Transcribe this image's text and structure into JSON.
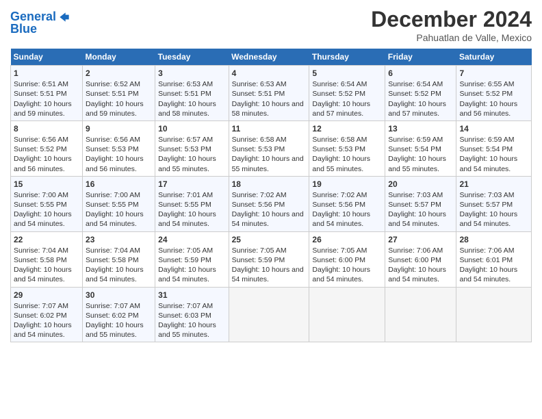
{
  "header": {
    "logo_line1": "General",
    "logo_line2": "Blue",
    "title": "December 2024",
    "subtitle": "Pahuatlan de Valle, Mexico"
  },
  "calendar": {
    "days_of_week": [
      "Sunday",
      "Monday",
      "Tuesday",
      "Wednesday",
      "Thursday",
      "Friday",
      "Saturday"
    ],
    "weeks": [
      [
        {
          "day": "1",
          "sunrise": "6:51 AM",
          "sunset": "5:51 PM",
          "daylight": "10 hours and 59 minutes."
        },
        {
          "day": "2",
          "sunrise": "6:52 AM",
          "sunset": "5:51 PM",
          "daylight": "10 hours and 59 minutes."
        },
        {
          "day": "3",
          "sunrise": "6:53 AM",
          "sunset": "5:51 PM",
          "daylight": "10 hours and 58 minutes."
        },
        {
          "day": "4",
          "sunrise": "6:53 AM",
          "sunset": "5:51 PM",
          "daylight": "10 hours and 58 minutes."
        },
        {
          "day": "5",
          "sunrise": "6:54 AM",
          "sunset": "5:52 PM",
          "daylight": "10 hours and 57 minutes."
        },
        {
          "day": "6",
          "sunrise": "6:54 AM",
          "sunset": "5:52 PM",
          "daylight": "10 hours and 57 minutes."
        },
        {
          "day": "7",
          "sunrise": "6:55 AM",
          "sunset": "5:52 PM",
          "daylight": "10 hours and 56 minutes."
        }
      ],
      [
        {
          "day": "8",
          "sunrise": "6:56 AM",
          "sunset": "5:52 PM",
          "daylight": "10 hours and 56 minutes."
        },
        {
          "day": "9",
          "sunrise": "6:56 AM",
          "sunset": "5:53 PM",
          "daylight": "10 hours and 56 minutes."
        },
        {
          "day": "10",
          "sunrise": "6:57 AM",
          "sunset": "5:53 PM",
          "daylight": "10 hours and 55 minutes."
        },
        {
          "day": "11",
          "sunrise": "6:58 AM",
          "sunset": "5:53 PM",
          "daylight": "10 hours and 55 minutes."
        },
        {
          "day": "12",
          "sunrise": "6:58 AM",
          "sunset": "5:53 PM",
          "daylight": "10 hours and 55 minutes."
        },
        {
          "day": "13",
          "sunrise": "6:59 AM",
          "sunset": "5:54 PM",
          "daylight": "10 hours and 55 minutes."
        },
        {
          "day": "14",
          "sunrise": "6:59 AM",
          "sunset": "5:54 PM",
          "daylight": "10 hours and 54 minutes."
        }
      ],
      [
        {
          "day": "15",
          "sunrise": "7:00 AM",
          "sunset": "5:55 PM",
          "daylight": "10 hours and 54 minutes."
        },
        {
          "day": "16",
          "sunrise": "7:00 AM",
          "sunset": "5:55 PM",
          "daylight": "10 hours and 54 minutes."
        },
        {
          "day": "17",
          "sunrise": "7:01 AM",
          "sunset": "5:55 PM",
          "daylight": "10 hours and 54 minutes."
        },
        {
          "day": "18",
          "sunrise": "7:02 AM",
          "sunset": "5:56 PM",
          "daylight": "10 hours and 54 minutes."
        },
        {
          "day": "19",
          "sunrise": "7:02 AM",
          "sunset": "5:56 PM",
          "daylight": "10 hours and 54 minutes."
        },
        {
          "day": "20",
          "sunrise": "7:03 AM",
          "sunset": "5:57 PM",
          "daylight": "10 hours and 54 minutes."
        },
        {
          "day": "21",
          "sunrise": "7:03 AM",
          "sunset": "5:57 PM",
          "daylight": "10 hours and 54 minutes."
        }
      ],
      [
        {
          "day": "22",
          "sunrise": "7:04 AM",
          "sunset": "5:58 PM",
          "daylight": "10 hours and 54 minutes."
        },
        {
          "day": "23",
          "sunrise": "7:04 AM",
          "sunset": "5:58 PM",
          "daylight": "10 hours and 54 minutes."
        },
        {
          "day": "24",
          "sunrise": "7:05 AM",
          "sunset": "5:59 PM",
          "daylight": "10 hours and 54 minutes."
        },
        {
          "day": "25",
          "sunrise": "7:05 AM",
          "sunset": "5:59 PM",
          "daylight": "10 hours and 54 minutes."
        },
        {
          "day": "26",
          "sunrise": "7:05 AM",
          "sunset": "6:00 PM",
          "daylight": "10 hours and 54 minutes."
        },
        {
          "day": "27",
          "sunrise": "7:06 AM",
          "sunset": "6:00 PM",
          "daylight": "10 hours and 54 minutes."
        },
        {
          "day": "28",
          "sunrise": "7:06 AM",
          "sunset": "6:01 PM",
          "daylight": "10 hours and 54 minutes."
        }
      ],
      [
        {
          "day": "29",
          "sunrise": "7:07 AM",
          "sunset": "6:02 PM",
          "daylight": "10 hours and 54 minutes."
        },
        {
          "day": "30",
          "sunrise": "7:07 AM",
          "sunset": "6:02 PM",
          "daylight": "10 hours and 55 minutes."
        },
        {
          "day": "31",
          "sunrise": "7:07 AM",
          "sunset": "6:03 PM",
          "daylight": "10 hours and 55 minutes."
        },
        null,
        null,
        null,
        null
      ]
    ]
  }
}
